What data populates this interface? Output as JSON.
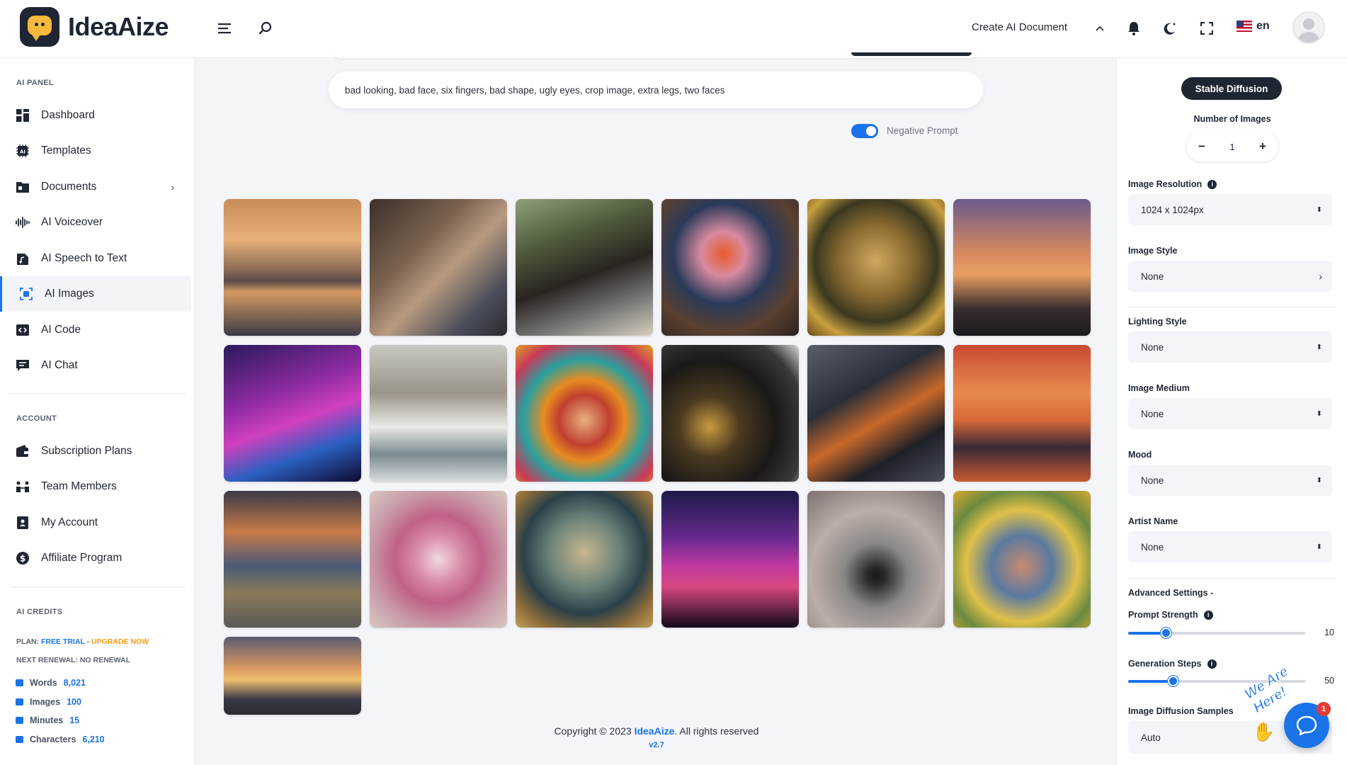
{
  "header": {
    "brand": "IdeaAize",
    "create_doc": "Create AI Document",
    "lang": "en"
  },
  "sidebar": {
    "panel_title": "AI PANEL",
    "items": [
      {
        "label": "Dashboard",
        "icon": "dashboard-icon"
      },
      {
        "label": "Templates",
        "icon": "ai-chip-icon"
      },
      {
        "label": "Documents",
        "icon": "folder-icon"
      },
      {
        "label": "AI Voiceover",
        "icon": "waveform-icon"
      },
      {
        "label": "AI Speech to Text",
        "icon": "audio-file-icon"
      },
      {
        "label": "AI Images",
        "icon": "image-scan-icon"
      },
      {
        "label": "AI Code",
        "icon": "code-icon"
      },
      {
        "label": "AI Chat",
        "icon": "chat-icon"
      }
    ],
    "account_title": "ACCOUNT",
    "account_items": [
      {
        "label": "Subscription Plans",
        "icon": "wallet-icon"
      },
      {
        "label": "Team Members",
        "icon": "team-icon"
      },
      {
        "label": "My Account",
        "icon": "user-card-icon"
      },
      {
        "label": "Affiliate Program",
        "icon": "dollar-icon"
      }
    ],
    "credits_title": "AI CREDITS",
    "plan_prefix": "PLAN:",
    "plan_name": "FREE TRIAL",
    "plan_sep": " - ",
    "upgrade": "UPGRADE NOW",
    "renewal": "NEXT RENEWAL: NO RENEWAL",
    "credits": [
      {
        "label": "Words",
        "value": "8,021"
      },
      {
        "label": "Images",
        "value": "100"
      },
      {
        "label": "Minutes",
        "value": "15"
      },
      {
        "label": "Characters",
        "value": "6,210"
      }
    ]
  },
  "main": {
    "negative_prompt": "bad looking, bad face, six fingers, bad shape, ugly eyes, crop image, extra legs, two faces",
    "negative_toggle_label": "Negative Prompt",
    "negative_toggle_on": true,
    "images": [
      "sunset-sea-ship",
      "friends-laughing",
      "friends-phone",
      "flower-vase",
      "mona-lisa",
      "eiffel-tower",
      "neon-city-car",
      "snowy-forest",
      "frida-portrait",
      "cat-window",
      "city-night-aerial",
      "sunset-lake",
      "mountain-sunset",
      "pink-dahlia",
      "surreal-painting",
      "cyberpunk-city",
      "tree-reflection",
      "woman-sunflowers",
      "cruise-ship-sunset"
    ],
    "footer_prefix": "Copyright © 2023 ",
    "footer_brand": "IdeaAize",
    "footer_suffix": ". All rights reserved",
    "version": "v2.7"
  },
  "panel": {
    "engine": "Stable Diffusion",
    "num_images_label": "Number of Images",
    "num_images": "1",
    "resolution_label": "Image Resolution",
    "resolution": "1024 x 1024px",
    "style_label": "Image Style",
    "style": "None",
    "lighting_label": "Lighting Style",
    "lighting": "None",
    "medium_label": "Image Medium",
    "medium": "None",
    "mood_label": "Mood",
    "mood": "None",
    "artist_label": "Artist Name",
    "artist": "None",
    "advanced_label": "Advanced Settings -",
    "prompt_strength_label": "Prompt Strength",
    "prompt_strength": "10",
    "prompt_strength_fraction": 0.21,
    "gen_steps_label": "Generation Steps",
    "gen_steps": "50",
    "gen_steps_fraction": 0.25,
    "samples_label": "Image Diffusion Samples",
    "samples": "Auto"
  },
  "chat": {
    "badge": "1",
    "tagline": "We Are Here!"
  },
  "colors": {
    "accent": "#1a73e8",
    "dark": "#1f2633",
    "upgrade": "#f39c12"
  }
}
